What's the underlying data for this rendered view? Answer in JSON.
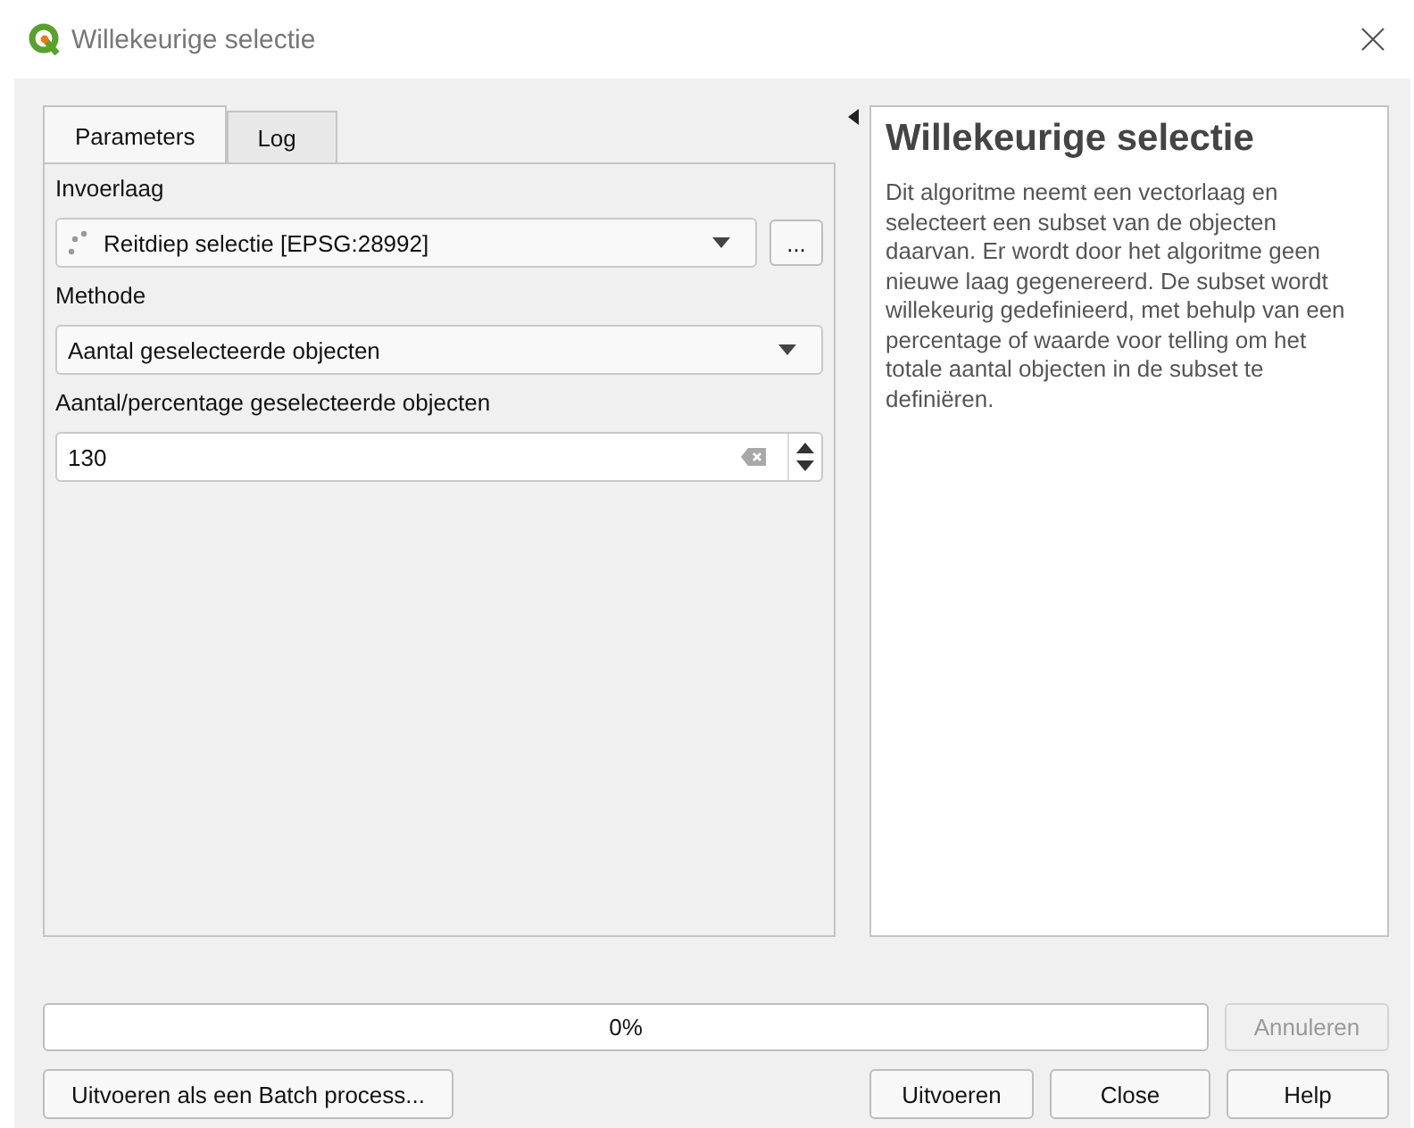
{
  "window": {
    "title": "Willekeurige selectie"
  },
  "tabs": [
    {
      "label": "Parameters",
      "selected": true
    },
    {
      "label": "Log",
      "selected": false
    }
  ],
  "parameters": [
    {
      "kind": "layer",
      "label": "Invoerlaag",
      "value": "Reitdiep selectie [EPSG:28992]",
      "browse": "..."
    },
    {
      "kind": "combo",
      "label": "Methode",
      "value": "Aantal geselecteerde objecten"
    },
    {
      "kind": "spin",
      "label": "Aantal/percentage geselecteerde objecten",
      "value": "130"
    }
  ],
  "description": {
    "title": "Willekeurige selectie",
    "text": "Dit algoritme neemt een vectorlaag en selecteert een subset van de objecten daarvan. Er wordt door het algoritme geen nieuwe laag gegenereerd. De subset wordt willekeurig gedefinieerd, met behulp van een percentage of waarde voor telling om het totale aantal objecten in de subset te definiëren."
  },
  "progress": {
    "level": 0,
    "text": "0%"
  },
  "cancel_button": {
    "label": "Annuleren",
    "disabled": true
  },
  "buttons": [
    {
      "label": "Uitvoeren als een Batch process..."
    },
    {
      "label": "Uitvoeren"
    },
    {
      "label": "Close"
    },
    {
      "label": "Help"
    }
  ]
}
